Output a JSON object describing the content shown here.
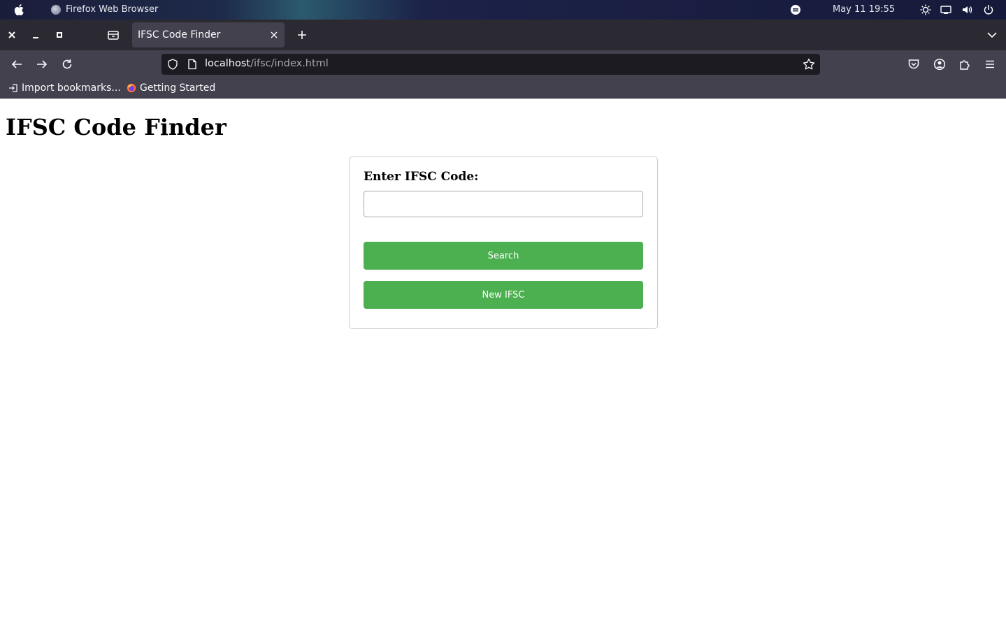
{
  "os": {
    "app_name": "Firefox Web Browser",
    "datetime": "May 11  19:55"
  },
  "browser": {
    "tab_title": "IFSC Code Finder",
    "url_host": "localhost",
    "url_path": "/ifsc/index.html",
    "bookmarks": [
      {
        "label": "Import bookmarks..."
      },
      {
        "label": "Getting Started"
      }
    ]
  },
  "page": {
    "title": "IFSC Code Finder",
    "form": {
      "label": "Enter IFSC Code:",
      "input_value": "",
      "input_placeholder": "",
      "search_label": "Search",
      "new_label": "New IFSC"
    }
  },
  "colors": {
    "button_green": "#4caf50",
    "browser_chrome": "#2b2a33",
    "toolbar": "#42414d"
  }
}
